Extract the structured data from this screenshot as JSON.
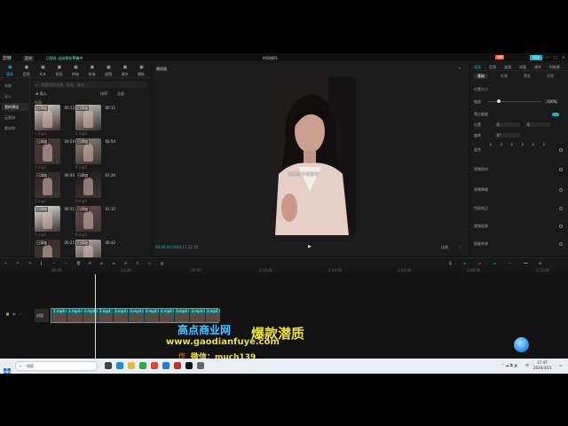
{
  "window": {
    "app_name": "剪映",
    "project_title": "时间线01",
    "autosave_text": "已保存 自动保存草稿中",
    "export_label": "导出",
    "pro_label": "VIP"
  },
  "toolbar_tabs": [
    {
      "label": "媒体",
      "icon": "media-icon"
    },
    {
      "label": "音频",
      "icon": "audio-icon"
    },
    {
      "label": "文本",
      "icon": "text-icon"
    },
    {
      "label": "贴纸",
      "icon": "sticker-icon"
    },
    {
      "label": "特效",
      "icon": "effects-icon"
    },
    {
      "label": "转场",
      "icon": "transition-icon"
    },
    {
      "label": "滤镜",
      "icon": "filter-icon"
    },
    {
      "label": "调节",
      "icon": "adjust-icon"
    },
    {
      "label": "模板",
      "icon": "template-icon"
    }
  ],
  "media_sidebar": {
    "items": [
      "本地",
      "导入",
      "我的预设",
      "云素材",
      "素材库"
    ],
    "selected": 2
  },
  "media_search": {
    "placeholder": "搜索文件名称、标签、备注"
  },
  "media_header": {
    "import_label": "导入",
    "sort_label": "排序",
    "filter_label": "全部"
  },
  "media_group_label": "批量",
  "media_clips": [
    {
      "tag": "已添加",
      "dur": "00:13",
      "name": "1.mp4",
      "color": "#d8d0c8"
    },
    {
      "tag": "已添加",
      "dur": "00:11",
      "name": "2.mp4",
      "color": "#c9c2b8"
    },
    {
      "tag": "已添加",
      "dur": "00:59",
      "name": "3.mp4",
      "color": "#4a3a38"
    },
    {
      "tag": "已添加",
      "dur": "00:54",
      "name": "4.mp4",
      "color": "#8a7f74"
    },
    {
      "tag": "已添加",
      "dur": "00:40",
      "name": "5.mp4",
      "color": "#2d2826"
    },
    {
      "tag": "已添加",
      "dur": "01:26",
      "name": "6.mp4",
      "color": "#201c1c"
    },
    {
      "tag": "已添加",
      "dur": "00:51",
      "name": "7.mp4",
      "color": "#e6e2de"
    },
    {
      "tag": "已添加",
      "dur": "01:32",
      "name": "8.mp4",
      "color": "#6b4a46"
    },
    {
      "tag": "已添加",
      "dur": "00:25",
      "name": "9.mp4",
      "color": "#3a302d"
    },
    {
      "tag": "已添加",
      "dur": "00:42",
      "name": "10.mp4",
      "color": "#b8b0aa"
    }
  ],
  "player": {
    "title": "播放器",
    "subtitle": "难道你不想要吗",
    "current_time": "00:00:00:00",
    "total_time": "00:11:12:25",
    "ratio_label": "比例",
    "fullscreen_label": "全屏"
  },
  "inspector": {
    "tabs": [
      "画面",
      "音频",
      "变速",
      "动画",
      "调节",
      "AI效果"
    ],
    "subtabs": [
      "基础",
      "抠像",
      "蒙版",
      "背景"
    ],
    "rows": [
      "位置大小",
      "缩放",
      "等比缩放",
      "位置",
      "旋转",
      "混合",
      "视频防抖",
      "视频降噪",
      "色彩校正",
      "视频抠像",
      "智能补帧"
    ],
    "scale_value": "100%",
    "pos_x": "0",
    "pos_y": "0",
    "rotation": "0°"
  },
  "timeline": {
    "ruler_marks": [
      "00:00",
      "15:00",
      "|30:00",
      "1:15:00",
      "1:30:00",
      "1:45:00",
      "2:00:00",
      "2:15:00",
      "2:30:00"
    ],
    "track_label": "封面",
    "clip_labels": [
      "1.mp4 00:",
      "1.mp4 00:",
      "2.mp4 0000",
      "3.mp4",
      "3.mp4 00",
      "3.mp4 0001",
      "3.mp4 00",
      "3.mp4 0001",
      "3.mp4 00:",
      "3.mp4 0001",
      "3.mp4 0001 00:n"
    ]
  },
  "watermark": {
    "site_name": "高点商业网",
    "slogan": "爆款潜质",
    "url": "www.gaodianfuye.com",
    "wechat": "微信：much139",
    "ghost_text": "作"
  },
  "taskbar": {
    "search_placeholder": "搜索",
    "time": "17:47",
    "date": "2024/3/15",
    "lang": "中"
  },
  "colors": {
    "accent": "#19b8c4",
    "panel": "#1a1a1a",
    "watermark_yellow": "#f2e33a"
  }
}
